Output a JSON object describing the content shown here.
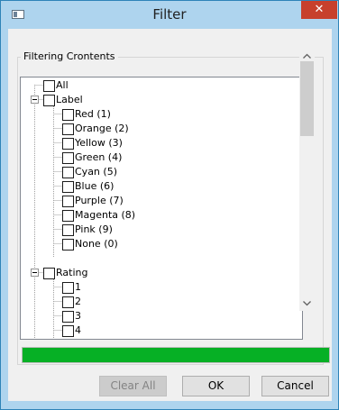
{
  "window": {
    "title": "Filter",
    "close_glyph": "✕",
    "accent": "#aed4ee"
  },
  "group": {
    "legend": "Filtering Crontents"
  },
  "tree": {
    "all_label": "All",
    "label_node": "Label",
    "labels": [
      "Red (1)",
      "Orange (2)",
      "Yellow (3)",
      "Green (4)",
      "Cyan (5)",
      "Blue (6)",
      "Purple (7)",
      "Magenta (8)",
      "Pink (9)",
      "None (0)"
    ],
    "rating_node": "Rating",
    "ratings": [
      "1",
      "2",
      "3",
      "4"
    ]
  },
  "progress": {
    "fraction": 1.0,
    "color": "#06b025"
  },
  "buttons": {
    "clear_all": "Clear All",
    "ok": "OK",
    "cancel": "Cancel"
  },
  "icons": {
    "app": "window-icon",
    "expander": "collapse-minus-icon",
    "scroll_up": "chevron-up-icon",
    "scroll_down": "chevron-down-icon"
  }
}
